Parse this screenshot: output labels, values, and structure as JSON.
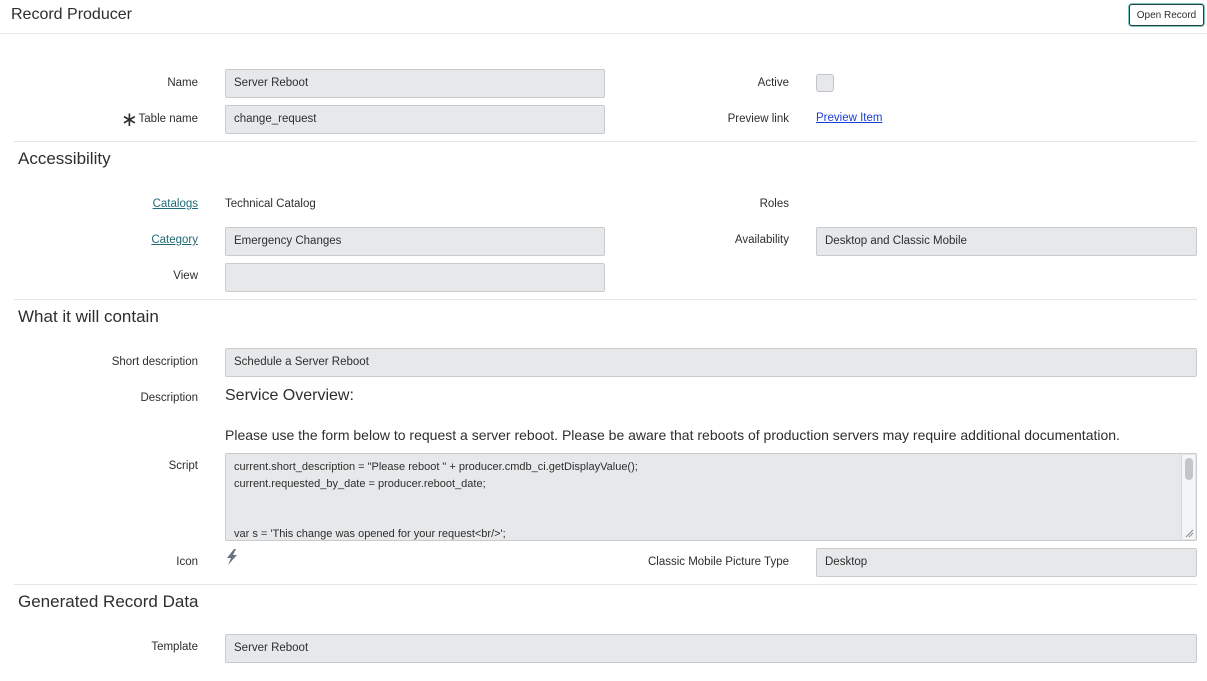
{
  "header": {
    "title": "Record Producer",
    "open_record_label": "Open Record"
  },
  "basic": {
    "name_label": "Name",
    "name_value": "Server Reboot",
    "active_label": "Active",
    "table_name_label": "Table name",
    "table_name_value": "change_request",
    "preview_link_label": "Preview link",
    "preview_link_text": "Preview Item"
  },
  "accessibility": {
    "title": "Accessibility",
    "catalogs_label": "Catalogs",
    "catalogs_value": "Technical Catalog",
    "roles_label": "Roles",
    "category_label": "Category",
    "category_value": "Emergency Changes",
    "availability_label": "Availability",
    "availability_value": "Desktop and Classic Mobile",
    "view_label": "View",
    "view_value": ""
  },
  "contain": {
    "title": "What it will contain",
    "short_description_label": "Short description",
    "short_description_value": "Schedule a Server Reboot",
    "description_label": "Description",
    "description_heading": "Service Overview:",
    "description_body": "Please use the form below to request a server reboot. Please be aware that reboots of production servers may require additional documentation.",
    "script_label": "Script",
    "script_lines": [
      "current.short_description = \"Please reboot \" + producer.cmdb_ci.getDisplayValue();",
      "current.requested_by_date = producer.reboot_date;",
      "",
      "",
      "var s = 'This change was opened for your request<br/>';"
    ],
    "icon_label": "Icon",
    "icon_name": "lightning-bolt-icon",
    "picture_type_label": "Classic Mobile Picture Type",
    "picture_type_value": "Desktop"
  },
  "generated": {
    "title": "Generated Record Data",
    "template_label": "Template",
    "template_value": "Server Reboot"
  }
}
